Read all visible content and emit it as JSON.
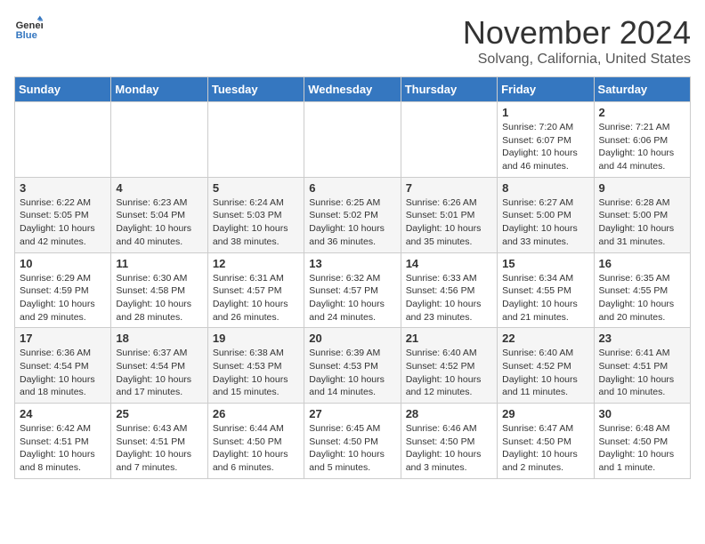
{
  "header": {
    "logo_general": "General",
    "logo_blue": "Blue",
    "month": "November 2024",
    "location": "Solvang, California, United States"
  },
  "weekdays": [
    "Sunday",
    "Monday",
    "Tuesday",
    "Wednesday",
    "Thursday",
    "Friday",
    "Saturday"
  ],
  "weeks": [
    [
      {
        "day": "",
        "info": ""
      },
      {
        "day": "",
        "info": ""
      },
      {
        "day": "",
        "info": ""
      },
      {
        "day": "",
        "info": ""
      },
      {
        "day": "",
        "info": ""
      },
      {
        "day": "1",
        "info": "Sunrise: 7:20 AM\nSunset: 6:07 PM\nDaylight: 10 hours\nand 46 minutes."
      },
      {
        "day": "2",
        "info": "Sunrise: 7:21 AM\nSunset: 6:06 PM\nDaylight: 10 hours\nand 44 minutes."
      }
    ],
    [
      {
        "day": "3",
        "info": "Sunrise: 6:22 AM\nSunset: 5:05 PM\nDaylight: 10 hours\nand 42 minutes."
      },
      {
        "day": "4",
        "info": "Sunrise: 6:23 AM\nSunset: 5:04 PM\nDaylight: 10 hours\nand 40 minutes."
      },
      {
        "day": "5",
        "info": "Sunrise: 6:24 AM\nSunset: 5:03 PM\nDaylight: 10 hours\nand 38 minutes."
      },
      {
        "day": "6",
        "info": "Sunrise: 6:25 AM\nSunset: 5:02 PM\nDaylight: 10 hours\nand 36 minutes."
      },
      {
        "day": "7",
        "info": "Sunrise: 6:26 AM\nSunset: 5:01 PM\nDaylight: 10 hours\nand 35 minutes."
      },
      {
        "day": "8",
        "info": "Sunrise: 6:27 AM\nSunset: 5:00 PM\nDaylight: 10 hours\nand 33 minutes."
      },
      {
        "day": "9",
        "info": "Sunrise: 6:28 AM\nSunset: 5:00 PM\nDaylight: 10 hours\nand 31 minutes."
      }
    ],
    [
      {
        "day": "10",
        "info": "Sunrise: 6:29 AM\nSunset: 4:59 PM\nDaylight: 10 hours\nand 29 minutes."
      },
      {
        "day": "11",
        "info": "Sunrise: 6:30 AM\nSunset: 4:58 PM\nDaylight: 10 hours\nand 28 minutes."
      },
      {
        "day": "12",
        "info": "Sunrise: 6:31 AM\nSunset: 4:57 PM\nDaylight: 10 hours\nand 26 minutes."
      },
      {
        "day": "13",
        "info": "Sunrise: 6:32 AM\nSunset: 4:57 PM\nDaylight: 10 hours\nand 24 minutes."
      },
      {
        "day": "14",
        "info": "Sunrise: 6:33 AM\nSunset: 4:56 PM\nDaylight: 10 hours\nand 23 minutes."
      },
      {
        "day": "15",
        "info": "Sunrise: 6:34 AM\nSunset: 4:55 PM\nDaylight: 10 hours\nand 21 minutes."
      },
      {
        "day": "16",
        "info": "Sunrise: 6:35 AM\nSunset: 4:55 PM\nDaylight: 10 hours\nand 20 minutes."
      }
    ],
    [
      {
        "day": "17",
        "info": "Sunrise: 6:36 AM\nSunset: 4:54 PM\nDaylight: 10 hours\nand 18 minutes."
      },
      {
        "day": "18",
        "info": "Sunrise: 6:37 AM\nSunset: 4:54 PM\nDaylight: 10 hours\nand 17 minutes."
      },
      {
        "day": "19",
        "info": "Sunrise: 6:38 AM\nSunset: 4:53 PM\nDaylight: 10 hours\nand 15 minutes."
      },
      {
        "day": "20",
        "info": "Sunrise: 6:39 AM\nSunset: 4:53 PM\nDaylight: 10 hours\nand 14 minutes."
      },
      {
        "day": "21",
        "info": "Sunrise: 6:40 AM\nSunset: 4:52 PM\nDaylight: 10 hours\nand 12 minutes."
      },
      {
        "day": "22",
        "info": "Sunrise: 6:40 AM\nSunset: 4:52 PM\nDaylight: 10 hours\nand 11 minutes."
      },
      {
        "day": "23",
        "info": "Sunrise: 6:41 AM\nSunset: 4:51 PM\nDaylight: 10 hours\nand 10 minutes."
      }
    ],
    [
      {
        "day": "24",
        "info": "Sunrise: 6:42 AM\nSunset: 4:51 PM\nDaylight: 10 hours\nand 8 minutes."
      },
      {
        "day": "25",
        "info": "Sunrise: 6:43 AM\nSunset: 4:51 PM\nDaylight: 10 hours\nand 7 minutes."
      },
      {
        "day": "26",
        "info": "Sunrise: 6:44 AM\nSunset: 4:50 PM\nDaylight: 10 hours\nand 6 minutes."
      },
      {
        "day": "27",
        "info": "Sunrise: 6:45 AM\nSunset: 4:50 PM\nDaylight: 10 hours\nand 5 minutes."
      },
      {
        "day": "28",
        "info": "Sunrise: 6:46 AM\nSunset: 4:50 PM\nDaylight: 10 hours\nand 3 minutes."
      },
      {
        "day": "29",
        "info": "Sunrise: 6:47 AM\nSunset: 4:50 PM\nDaylight: 10 hours\nand 2 minutes."
      },
      {
        "day": "30",
        "info": "Sunrise: 6:48 AM\nSunset: 4:50 PM\nDaylight: 10 hours\nand 1 minute."
      }
    ]
  ]
}
